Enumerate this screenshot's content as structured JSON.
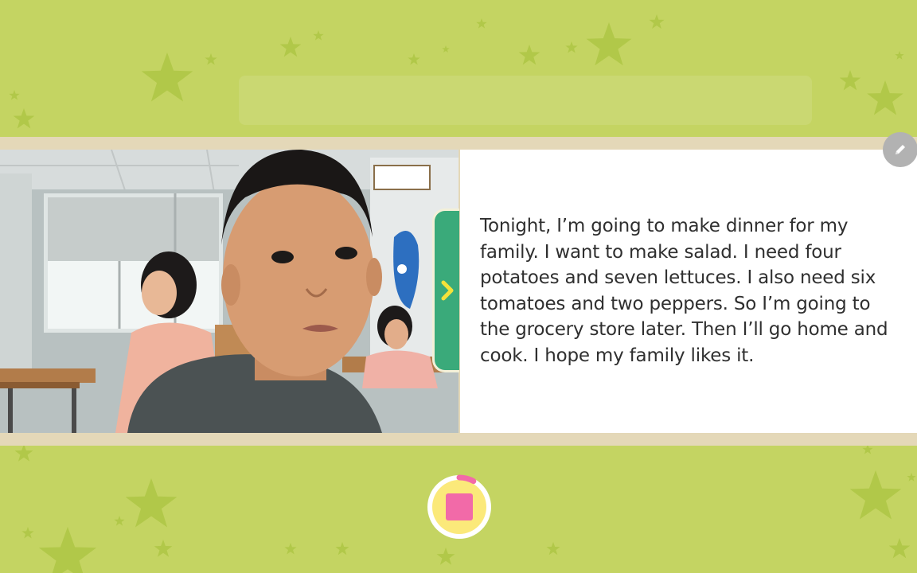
{
  "reading": {
    "text": "Tonight, I’m going to make dinner for my family. I want to make salad. I need four potatoes and seven lettuces. I also need six tomatoes and two peppers. So I’m going to the grocery store later. Then I’ll go home and cook. I hope my family likes it."
  },
  "controls": {
    "edit_icon": "pencil-icon",
    "next_icon": "chevron-right-icon",
    "record_icon": "stop-icon",
    "recording_progress": 0.08
  },
  "colors": {
    "background": "#c4d462",
    "star": "#a9c23f",
    "frame": "#e4d8b8",
    "next_tab": "#3aaa7a",
    "chevron": "#f5e23a",
    "record_ring": "#fbe97a",
    "record_stop": "#f26aa8"
  }
}
